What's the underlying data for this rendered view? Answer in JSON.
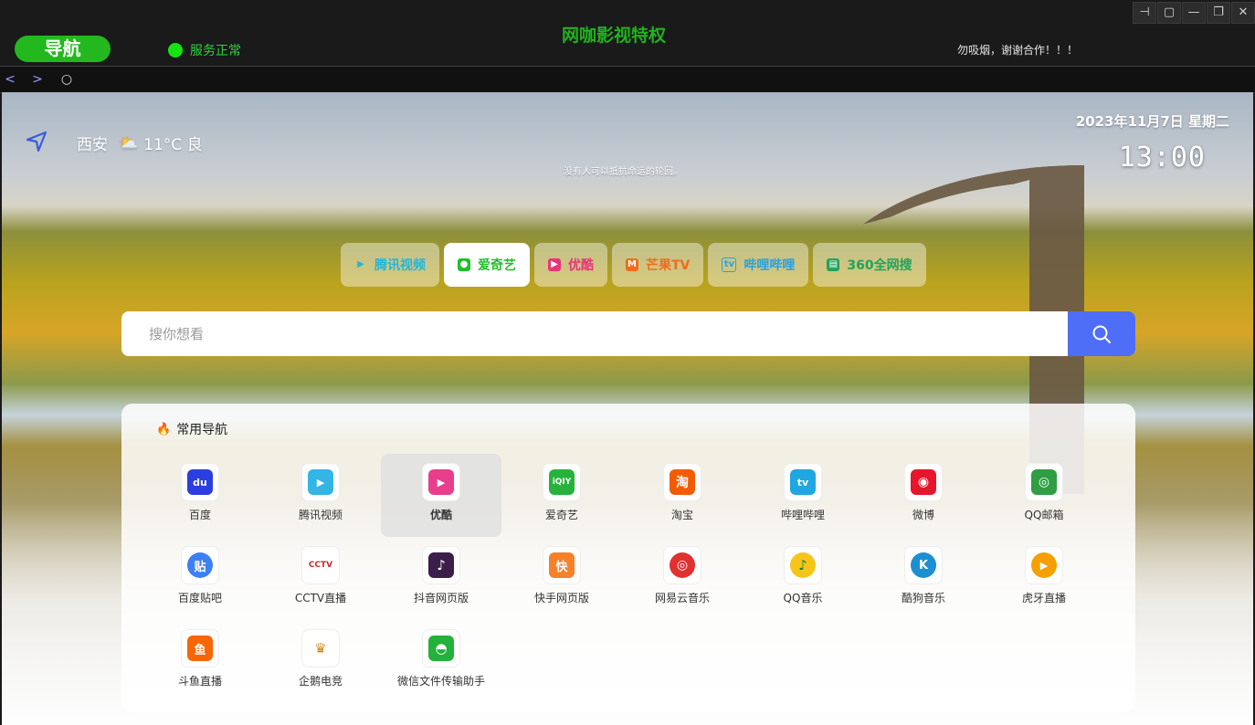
{
  "window": {
    "nav_label": "导航",
    "status_text": "服务正常",
    "app_title": "网咖影视特权",
    "notice": "勿吸烟，谢谢合作！！！",
    "controls": [
      "⊣",
      "▢",
      "—",
      "❐",
      "✕"
    ]
  },
  "toolbar": {
    "back": "<",
    "forward": ">",
    "refresh": "○"
  },
  "header": {
    "city": "西安",
    "weather": "11°C 良",
    "date": "2023年11月7日 星期二",
    "time": "13:00",
    "motto": "没有人可以抵抗命运的轮回。"
  },
  "engines": [
    {
      "label": "腾讯视频",
      "color": "#22b6d8",
      "icon": "▶",
      "active": false
    },
    {
      "label": "爱奇艺",
      "color": "#1fbf2a",
      "icon": "●",
      "active": true
    },
    {
      "label": "优酷",
      "color": "#e8347b",
      "icon": "▶",
      "active": false
    },
    {
      "label": "芒果TV",
      "color": "#f26b1d",
      "icon": "M",
      "active": false
    },
    {
      "label": "哔哩哔哩",
      "color": "#2aa1dd",
      "icon": "tv",
      "active": false
    },
    {
      "label": "360全网搜",
      "color": "#20a35a",
      "icon": "▤",
      "active": false
    }
  ],
  "search": {
    "placeholder": "搜你想看"
  },
  "panel": {
    "title": "常用导航",
    "items": [
      {
        "label": "百度",
        "color": "#2c3ee0",
        "glyph": "du"
      },
      {
        "label": "腾讯视频",
        "color": "#33b5e5",
        "glyph": "▶"
      },
      {
        "label": "优酷",
        "color": "#e83e8c",
        "glyph": "▶"
      },
      {
        "label": "爱奇艺",
        "color": "#27b33b",
        "glyph": "iQIY"
      },
      {
        "label": "淘宝",
        "color": "#f25c05",
        "glyph": "淘"
      },
      {
        "label": "哔哩哔哩",
        "color": "#20a6e0",
        "glyph": "tv"
      },
      {
        "label": "微博",
        "color": "#e6162d",
        "glyph": "◉"
      },
      {
        "label": "QQ邮箱",
        "color": "#2f9e44",
        "glyph": "◎"
      },
      {
        "label": "百度贴吧",
        "color": "#3d7ff5",
        "glyph": "贴"
      },
      {
        "label": "CCTV直播",
        "color": "#c92a2a",
        "glyph": "CCTV"
      },
      {
        "label": "抖音网页版",
        "color": "#3b1f4a",
        "glyph": "♪"
      },
      {
        "label": "快手网页版",
        "color": "#f7812a",
        "glyph": "快"
      },
      {
        "label": "网易云音乐",
        "color": "#e03131",
        "glyph": "◎"
      },
      {
        "label": "QQ音乐",
        "color": "#f5c518",
        "glyph": "♪"
      },
      {
        "label": "酷狗音乐",
        "color": "#1b8fd1",
        "glyph": "K"
      },
      {
        "label": "虎牙直播",
        "color": "#f59f00",
        "glyph": "▶"
      },
      {
        "label": "斗鱼直播",
        "color": "#f76707",
        "glyph": "鱼"
      },
      {
        "label": "企鹅电竞",
        "color": "#d08b1f",
        "glyph": "♛"
      },
      {
        "label": "微信文件传输助手",
        "color": "#22b13a",
        "glyph": "◓"
      }
    ]
  }
}
